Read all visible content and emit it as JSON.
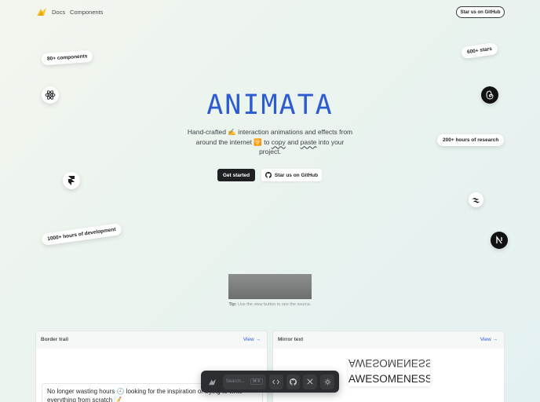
{
  "nav": {
    "docs": "Docs",
    "components": "Components",
    "github_button": "Star us on GitHub"
  },
  "pills": {
    "components": "80+ components",
    "stars": "600+ stars",
    "research": "200+ hours of research",
    "development": "1000+ hours of development"
  },
  "hero": {
    "title": "ANIMATA",
    "sub_1": "Hand-crafted ✍️ interaction animations and effects from around the internet 🛜 to ",
    "sub_copy": "copy",
    "sub_and": " and ",
    "sub_paste": "paste",
    "sub_2": " into your project.",
    "get_started": "Get started",
    "star_github": "Star us on GitHub"
  },
  "tip": {
    "label": "Tip:",
    "text": " Use the view button to see the source."
  },
  "cards": [
    {
      "title": "Border trail",
      "view": "View →",
      "message": "No longer wasting hours 🕘 looking for the inspiration or trying to write everything from scratch 📝"
    },
    {
      "title": "Mirror text",
      "view": "View →",
      "mirror_word": "AWESOMENESS"
    }
  ],
  "dock": {
    "search_placeholder": "Search...",
    "shortcut": "⌘ K"
  },
  "colors": {
    "accent": "#2d5bd0",
    "dark": "#1f2023"
  },
  "icons": {
    "logo": "animata-logo-icon",
    "react": "react-icon",
    "framer": "framer-icon",
    "tailwind": "tailwind-icon",
    "nextjs": "nextjs-icon",
    "threads": "threads-icon"
  }
}
